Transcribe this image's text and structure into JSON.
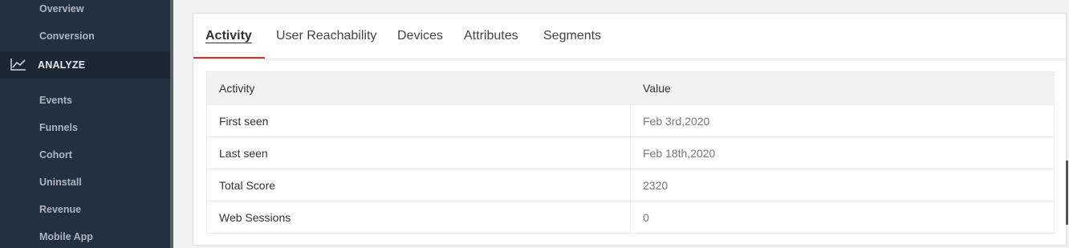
{
  "sidebar": {
    "items_top": [
      "Overview",
      "Conversion"
    ],
    "section": {
      "label": "ANALYZE",
      "icon": "line-chart-icon"
    },
    "items": [
      "Events",
      "Funnels",
      "Cohort",
      "Uninstall",
      "Revenue",
      "Mobile App"
    ]
  },
  "tabs": [
    "Activity",
    "User Reachability",
    "Devices",
    "Attributes",
    "Segments"
  ],
  "active_tab": "Activity",
  "table": {
    "headers": [
      "Activity",
      "Value"
    ],
    "rows": [
      [
        "First seen",
        "Feb 3rd,2020"
      ],
      [
        "Last seen",
        "Feb 18th,2020"
      ],
      [
        "Total Score",
        "2320"
      ],
      [
        "Web Sessions",
        "0"
      ]
    ]
  },
  "colors": {
    "sidebar_bg": "#23303f",
    "accent": "#d9302c"
  }
}
